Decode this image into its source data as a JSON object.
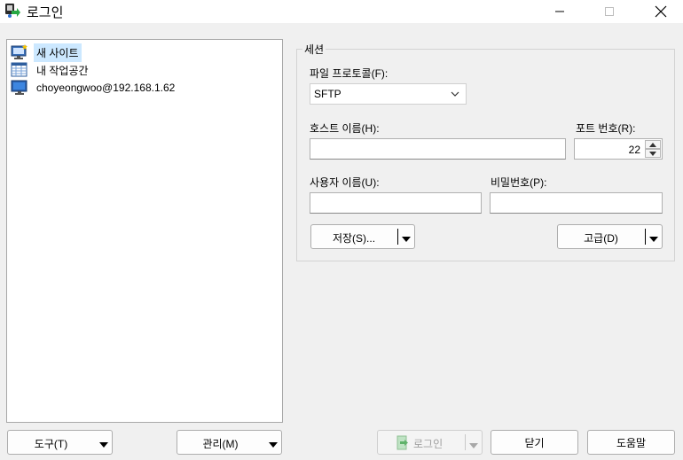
{
  "window": {
    "title": "로그인",
    "app_icon": "winscp-login-icon",
    "controls": [
      "minimize-icon",
      "maximize-icon",
      "close-icon"
    ]
  },
  "sites": [
    {
      "label": "새 사이트",
      "icon": "new-site-icon",
      "selected": true
    },
    {
      "label": "내 작업공간",
      "icon": "workspace-icon",
      "selected": false
    },
    {
      "label": "choyeongwoo@192.168.1.62",
      "icon": "site-icon",
      "selected": false
    }
  ],
  "session": {
    "legend": "세션",
    "protocol_label": "파일 프로토콜(F):",
    "protocol_value": "SFTP",
    "host_label": "호스트 이름(H):",
    "host_value": "",
    "port_label": "포트 번호(R):",
    "port_value": "22",
    "user_label": "사용자 이름(U):",
    "user_value": "",
    "password_label": "비밀번호(P):",
    "password_value": "",
    "save_button": "저장(S)...",
    "advanced_button": "고급(D)"
  },
  "footer": {
    "tools_button": "도구(T)",
    "manage_button": "관리(M)",
    "login_button": "로그인",
    "close_button": "닫기",
    "help_button": "도움말"
  }
}
